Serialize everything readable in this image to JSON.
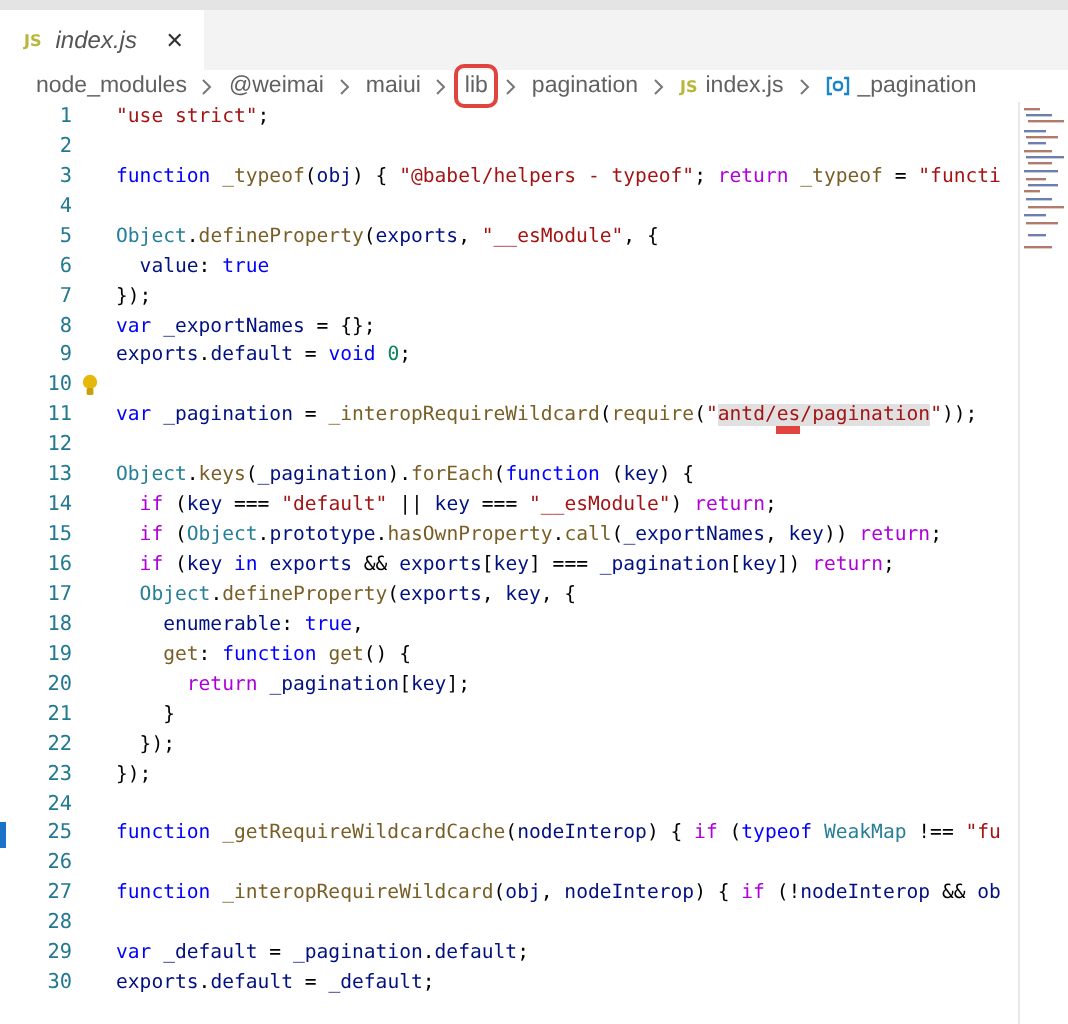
{
  "tab": {
    "icon": "JS",
    "label": "index.js",
    "close": "✕"
  },
  "breadcrumbs": [
    {
      "kind": "folder",
      "label": "node_modules",
      "boxed": false
    },
    {
      "kind": "folder",
      "label": "@weimai",
      "boxed": false
    },
    {
      "kind": "folder",
      "label": "maiui",
      "boxed": false
    },
    {
      "kind": "folder",
      "label": "lib",
      "boxed": true
    },
    {
      "kind": "folder",
      "label": "pagination",
      "boxed": false
    },
    {
      "kind": "file",
      "icon": "JS",
      "label": "index.js",
      "boxed": false
    },
    {
      "kind": "symbol",
      "label": "_pagination",
      "boxed": false
    }
  ],
  "lines": [
    {
      "n": "1",
      "kind": "code",
      "tokens": [
        {
          "kind": "s",
          "text": "\"use strict\""
        },
        {
          "kind": "p",
          "text": ";"
        }
      ]
    },
    {
      "n": "2",
      "kind": "code"
    },
    {
      "n": "3",
      "kind": "code",
      "tokens": [
        {
          "kind": "kw",
          "text": "function "
        },
        {
          "kind": "fn",
          "text": "_typeof"
        },
        {
          "kind": "p",
          "text": "("
        },
        {
          "kind": "v",
          "text": "obj"
        },
        {
          "kind": "p",
          "text": ") { "
        },
        {
          "kind": "s",
          "text": "\"@babel/helpers - typeof\""
        },
        {
          "kind": "p",
          "text": "; "
        },
        {
          "kind": "ctl",
          "text": "return "
        },
        {
          "kind": "fn",
          "text": "_typeof"
        },
        {
          "kind": "p",
          "text": " = "
        },
        {
          "kind": "s",
          "text": "\"functi"
        }
      ]
    },
    {
      "n": "4",
      "kind": "code"
    },
    {
      "n": "5",
      "kind": "code",
      "tokens": [
        {
          "kind": "cls",
          "text": "Object"
        },
        {
          "kind": "p",
          "text": "."
        },
        {
          "kind": "fn",
          "text": "defineProperty"
        },
        {
          "kind": "p",
          "text": "("
        },
        {
          "kind": "v",
          "text": "exports"
        },
        {
          "kind": "p",
          "text": ", "
        },
        {
          "kind": "s",
          "text": "\"__esModule\""
        },
        {
          "kind": "p",
          "text": ", {"
        }
      ]
    },
    {
      "n": "6",
      "kind": "code",
      "tokens": [
        {
          "kind": "v",
          "text": "  value"
        },
        {
          "kind": "p",
          "text": ": "
        },
        {
          "kind": "kw",
          "text": "true"
        }
      ]
    },
    {
      "n": "7",
      "kind": "code",
      "tokens": [
        {
          "kind": "p",
          "text": "});"
        }
      ]
    },
    {
      "n": "8",
      "kind": "code",
      "tokens": [
        {
          "kind": "kw",
          "text": "var "
        },
        {
          "kind": "v",
          "text": "_exportNames"
        },
        {
          "kind": "p",
          "text": " = {};"
        }
      ]
    },
    {
      "n": "9",
      "kind": "code",
      "tokens": [
        {
          "kind": "v",
          "text": "exports"
        },
        {
          "kind": "p",
          "text": "."
        },
        {
          "kind": "v",
          "text": "default"
        },
        {
          "kind": "p",
          "text": " = "
        },
        {
          "kind": "kw",
          "text": "void "
        },
        {
          "kind": "num",
          "text": "0"
        },
        {
          "kind": "p",
          "text": ";"
        }
      ]
    },
    {
      "n": "10",
      "kind": "bulb"
    },
    {
      "n": "11",
      "kind": "code",
      "tokens": [
        {
          "kind": "kw",
          "text": "var "
        },
        {
          "kind": "v",
          "text": "_pagination"
        },
        {
          "kind": "p",
          "text": " = "
        },
        {
          "kind": "fn",
          "text": "_interopRequireWildcard"
        },
        {
          "kind": "p",
          "text": "("
        },
        {
          "kind": "fn",
          "text": "require"
        },
        {
          "kind": "p",
          "text": "("
        },
        {
          "kind": "s",
          "text": "\""
        },
        {
          "kind": "sel",
          "text": "antd/"
        },
        {
          "kind": "selmark",
          "text": "es"
        },
        {
          "kind": "sel",
          "text": "/pagination"
        },
        {
          "kind": "s",
          "text": "\""
        },
        {
          "kind": "p",
          "text": "));"
        }
      ]
    },
    {
      "n": "12",
      "kind": "code"
    },
    {
      "n": "13",
      "kind": "code",
      "tokens": [
        {
          "kind": "cls",
          "text": "Object"
        },
        {
          "kind": "p",
          "text": "."
        },
        {
          "kind": "fn",
          "text": "keys"
        },
        {
          "kind": "p",
          "text": "("
        },
        {
          "kind": "v",
          "text": "_pagination"
        },
        {
          "kind": "p",
          "text": ")."
        },
        {
          "kind": "fn",
          "text": "forEach"
        },
        {
          "kind": "p",
          "text": "("
        },
        {
          "kind": "kw",
          "text": "function "
        },
        {
          "kind": "p",
          "text": "("
        },
        {
          "kind": "v",
          "text": "key"
        },
        {
          "kind": "p",
          "text": ") {"
        }
      ]
    },
    {
      "n": "14",
      "kind": "code",
      "tokens": [
        {
          "kind": "ctl",
          "text": "  if "
        },
        {
          "kind": "p",
          "text": "("
        },
        {
          "kind": "v",
          "text": "key"
        },
        {
          "kind": "p",
          "text": " === "
        },
        {
          "kind": "s",
          "text": "\"default\""
        },
        {
          "kind": "p",
          "text": " || "
        },
        {
          "kind": "v",
          "text": "key"
        },
        {
          "kind": "p",
          "text": " === "
        },
        {
          "kind": "s",
          "text": "\"__esModule\""
        },
        {
          "kind": "p",
          "text": ") "
        },
        {
          "kind": "ctl",
          "text": "return"
        },
        {
          "kind": "p",
          "text": ";"
        }
      ]
    },
    {
      "n": "15",
      "kind": "code",
      "tokens": [
        {
          "kind": "ctl",
          "text": "  if "
        },
        {
          "kind": "p",
          "text": "("
        },
        {
          "kind": "cls",
          "text": "Object"
        },
        {
          "kind": "p",
          "text": "."
        },
        {
          "kind": "v",
          "text": "prototype"
        },
        {
          "kind": "p",
          "text": "."
        },
        {
          "kind": "fn",
          "text": "hasOwnProperty"
        },
        {
          "kind": "p",
          "text": "."
        },
        {
          "kind": "fn",
          "text": "call"
        },
        {
          "kind": "p",
          "text": "("
        },
        {
          "kind": "v",
          "text": "_exportNames"
        },
        {
          "kind": "p",
          "text": ", "
        },
        {
          "kind": "v",
          "text": "key"
        },
        {
          "kind": "p",
          "text": ")) "
        },
        {
          "kind": "ctl",
          "text": "return"
        },
        {
          "kind": "p",
          "text": ";"
        }
      ]
    },
    {
      "n": "16",
      "kind": "code",
      "tokens": [
        {
          "kind": "ctl",
          "text": "  if "
        },
        {
          "kind": "p",
          "text": "("
        },
        {
          "kind": "v",
          "text": "key "
        },
        {
          "kind": "kw",
          "text": "in "
        },
        {
          "kind": "v",
          "text": "exports"
        },
        {
          "kind": "p",
          "text": " && "
        },
        {
          "kind": "v",
          "text": "exports"
        },
        {
          "kind": "p",
          "text": "["
        },
        {
          "kind": "v",
          "text": "key"
        },
        {
          "kind": "p",
          "text": "] === "
        },
        {
          "kind": "v",
          "text": "_pagination"
        },
        {
          "kind": "p",
          "text": "["
        },
        {
          "kind": "v",
          "text": "key"
        },
        {
          "kind": "p",
          "text": "]) "
        },
        {
          "kind": "ctl",
          "text": "return"
        },
        {
          "kind": "p",
          "text": ";"
        }
      ]
    },
    {
      "n": "17",
      "kind": "code",
      "tokens": [
        {
          "kind": "cls",
          "text": "  Object"
        },
        {
          "kind": "p",
          "text": "."
        },
        {
          "kind": "fn",
          "text": "defineProperty"
        },
        {
          "kind": "p",
          "text": "("
        },
        {
          "kind": "v",
          "text": "exports"
        },
        {
          "kind": "p",
          "text": ", "
        },
        {
          "kind": "v",
          "text": "key"
        },
        {
          "kind": "p",
          "text": ", {"
        }
      ]
    },
    {
      "n": "18",
      "kind": "code",
      "tokens": [
        {
          "kind": "v",
          "text": "    enumerable"
        },
        {
          "kind": "p",
          "text": ": "
        },
        {
          "kind": "kw",
          "text": "true"
        },
        {
          "kind": "p",
          "text": ","
        }
      ]
    },
    {
      "n": "19",
      "kind": "code",
      "tokens": [
        {
          "kind": "fn",
          "text": "    get"
        },
        {
          "kind": "p",
          "text": ": "
        },
        {
          "kind": "kw",
          "text": "function "
        },
        {
          "kind": "fn",
          "text": "get"
        },
        {
          "kind": "p",
          "text": "() {"
        }
      ]
    },
    {
      "n": "20",
      "kind": "code",
      "tokens": [
        {
          "kind": "ctl",
          "text": "      return "
        },
        {
          "kind": "v",
          "text": "_pagination"
        },
        {
          "kind": "p",
          "text": "["
        },
        {
          "kind": "v",
          "text": "key"
        },
        {
          "kind": "p",
          "text": "];"
        }
      ]
    },
    {
      "n": "21",
      "kind": "code",
      "tokens": [
        {
          "kind": "p",
          "text": "    }"
        }
      ]
    },
    {
      "n": "22",
      "kind": "code",
      "tokens": [
        {
          "kind": "p",
          "text": "  });"
        }
      ]
    },
    {
      "n": "23",
      "kind": "code",
      "tokens": [
        {
          "kind": "p",
          "text": "});"
        }
      ]
    },
    {
      "n": "24",
      "kind": "code"
    },
    {
      "n": "25",
      "kind": "changed",
      "tokens": [
        {
          "kind": "kw",
          "text": "function "
        },
        {
          "kind": "fn",
          "text": "_getRequireWildcardCache"
        },
        {
          "kind": "p",
          "text": "("
        },
        {
          "kind": "v",
          "text": "nodeInterop"
        },
        {
          "kind": "p",
          "text": ") { "
        },
        {
          "kind": "ctl",
          "text": "if "
        },
        {
          "kind": "p",
          "text": "("
        },
        {
          "kind": "kw",
          "text": "typeof "
        },
        {
          "kind": "cls",
          "text": "WeakMap"
        },
        {
          "kind": "p",
          "text": " !== "
        },
        {
          "kind": "s",
          "text": "\"fu"
        }
      ]
    },
    {
      "n": "26",
      "kind": "code"
    },
    {
      "n": "27",
      "kind": "code",
      "tokens": [
        {
          "kind": "kw",
          "text": "function "
        },
        {
          "kind": "fn",
          "text": "_interopRequireWildcard"
        },
        {
          "kind": "p",
          "text": "("
        },
        {
          "kind": "v",
          "text": "obj"
        },
        {
          "kind": "p",
          "text": ", "
        },
        {
          "kind": "v",
          "text": "nodeInterop"
        },
        {
          "kind": "p",
          "text": ") { "
        },
        {
          "kind": "ctl",
          "text": "if "
        },
        {
          "kind": "p",
          "text": "(!"
        },
        {
          "kind": "v",
          "text": "nodeInterop"
        },
        {
          "kind": "p",
          "text": " && "
        },
        {
          "kind": "v",
          "text": "ob"
        }
      ]
    },
    {
      "n": "28",
      "kind": "code"
    },
    {
      "n": "29",
      "kind": "code",
      "tokens": [
        {
          "kind": "kw",
          "text": "var "
        },
        {
          "kind": "v",
          "text": "_default"
        },
        {
          "kind": "p",
          "text": " = "
        },
        {
          "kind": "v",
          "text": "_pagination"
        },
        {
          "kind": "p",
          "text": "."
        },
        {
          "kind": "v",
          "text": "default"
        },
        {
          "kind": "p",
          "text": ";"
        }
      ]
    },
    {
      "n": "30",
      "kind": "code",
      "tokens": [
        {
          "kind": "v",
          "text": "exports"
        },
        {
          "kind": "p",
          "text": "."
        },
        {
          "kind": "v",
          "text": "default"
        },
        {
          "kind": "p",
          "text": " = "
        },
        {
          "kind": "v",
          "text": "_default"
        },
        {
          "kind": "p",
          "text": ";"
        }
      ]
    }
  ]
}
